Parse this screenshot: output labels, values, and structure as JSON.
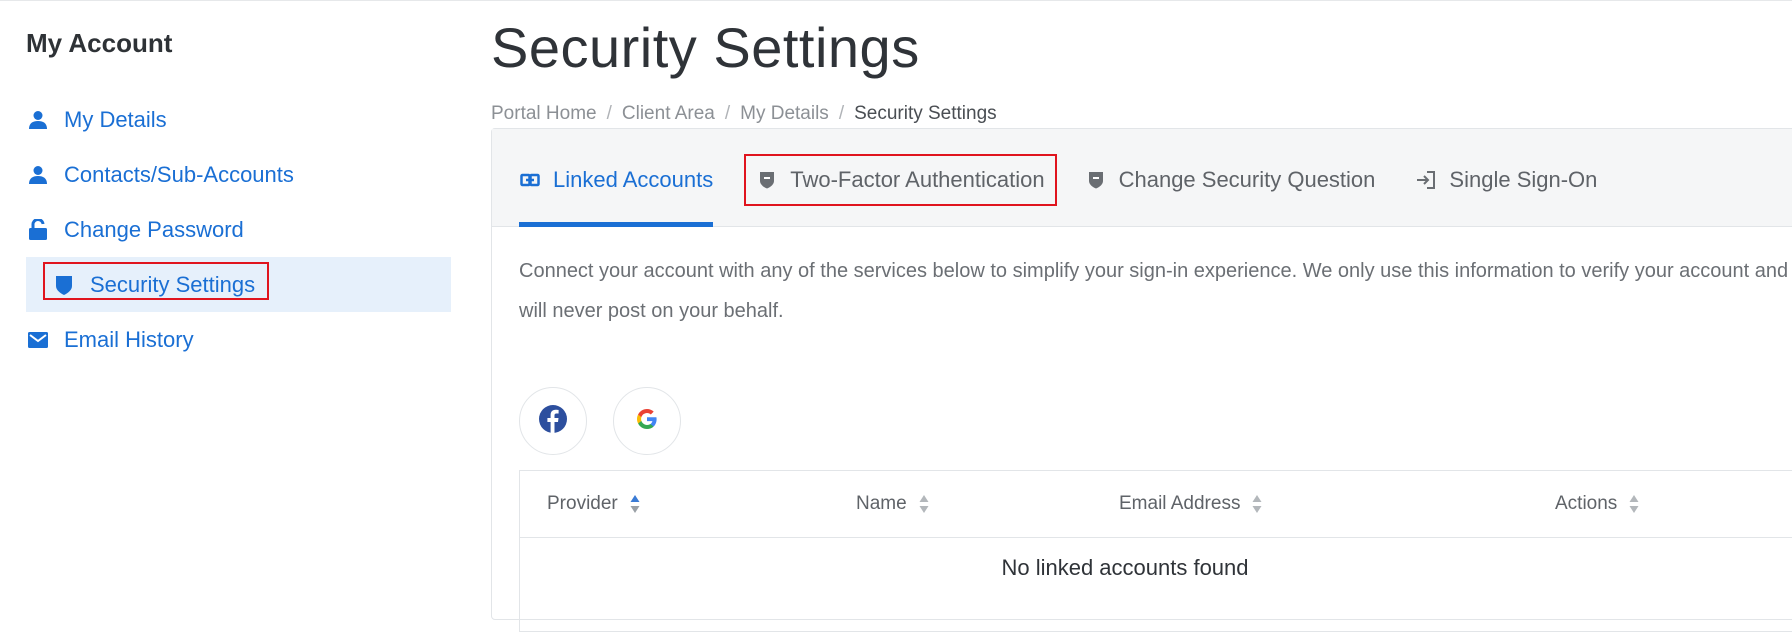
{
  "sidebar": {
    "title": "My Account",
    "items": [
      {
        "label": "My Details",
        "icon": "user-icon",
        "active": false
      },
      {
        "label": "Contacts/Sub-Accounts",
        "icon": "user-icon",
        "active": false
      },
      {
        "label": "Change Password",
        "icon": "unlock-icon",
        "active": false
      },
      {
        "label": "Security Settings",
        "icon": "shield-icon",
        "active": true
      },
      {
        "label": "Email History",
        "icon": "envelope-icon",
        "active": false
      }
    ]
  },
  "main": {
    "title": "Security Settings",
    "breadcrumb": [
      "Portal Home",
      "Client Area",
      "My Details",
      "Security Settings"
    ],
    "tabs": [
      {
        "label": "Linked Accounts",
        "icon": "link-icon",
        "active": true
      },
      {
        "label": "Two-Factor Authentication",
        "icon": "shield-icon",
        "active": false
      },
      {
        "label": "Change Security Question",
        "icon": "shield-icon",
        "active": false
      },
      {
        "label": "Single Sign-On",
        "icon": "sign-in-icon",
        "active": false
      }
    ],
    "description": "Connect your account with any of the services below to simplify your sign-in experience. We only use this information to verify your account and will never post on your behalf.",
    "social_buttons": [
      {
        "icon": "facebook-icon"
      },
      {
        "icon": "google-icon"
      }
    ],
    "table": {
      "columns": [
        "Provider",
        "Name",
        "Email Address",
        "Actions"
      ],
      "empty_message": "No linked accounts found"
    }
  },
  "colors": {
    "accent": "#1a6fd4",
    "highlight_box": "#e0141e",
    "active_bg": "#e6f0fb"
  }
}
